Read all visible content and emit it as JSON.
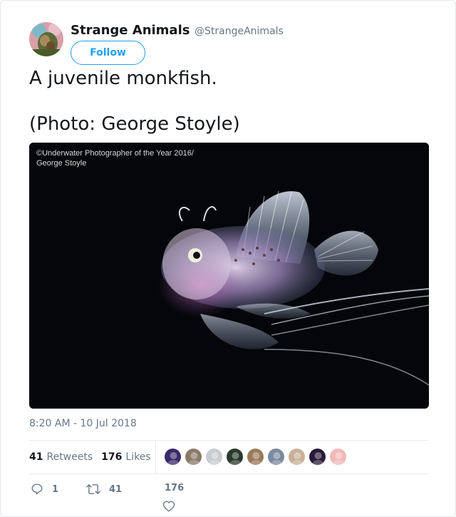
{
  "user": {
    "name": "Strange Animals",
    "handle": "@StrangeAnimals",
    "follow_label": "Follow"
  },
  "tweet": {
    "line1": "A juvenile monkfish.",
    "line2": "(Photo: George Stoyle)"
  },
  "media": {
    "watermark_line1": "©Underwater Photographer of the Year 2016/",
    "watermark_line2": "George Stoyle"
  },
  "timestamp": "8:20 AM - 10 Jul 2018",
  "stats": {
    "retweets_count": "41",
    "retweets_label": "Retweets",
    "likes_count": "176",
    "likes_label": "Likes"
  },
  "actions": {
    "reply_count": "1",
    "retweet_count": "41",
    "like_count": "176"
  },
  "colors": {
    "accent": "#1da1f2",
    "secondary_text": "#657786",
    "divider": "#e6ecf0"
  },
  "liker_avatar_colors": [
    "#3a2a6b",
    "#8a7a6a",
    "#c8ccd1",
    "#2a3a2a",
    "#9a7a5a",
    "#7a8aa0",
    "#c8b098",
    "#2a1a3a",
    "#f2b8b8"
  ]
}
